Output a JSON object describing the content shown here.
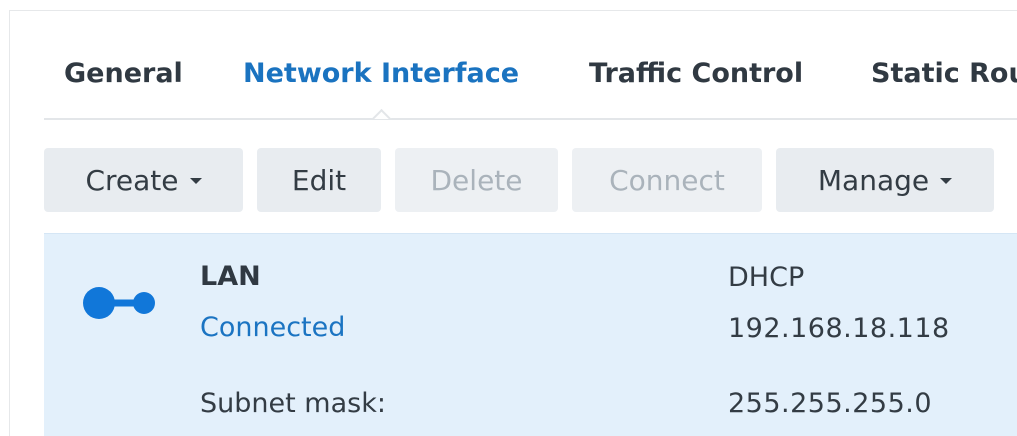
{
  "tabs": [
    {
      "label": "General",
      "active": false
    },
    {
      "label": "Network Interface",
      "active": true
    },
    {
      "label": "Traffic Control",
      "active": false
    },
    {
      "label": "Static Rou",
      "active": false
    }
  ],
  "toolbar": {
    "create_label": "Create",
    "edit_label": "Edit",
    "delete_label": "Delete",
    "connect_label": "Connect",
    "manage_label": "Manage"
  },
  "interface": {
    "icon": "connection-icon",
    "name": "LAN",
    "status": "Connected",
    "mode": "DHCP",
    "ip": "192.168.18.118",
    "subnet_label": "Subnet mask:",
    "subnet_value": "255.255.255.0"
  },
  "colors": {
    "accent": "#1a73c0",
    "icon_blue": "#1177d9",
    "selected_row": "#e3f0fb",
    "button_bg": "#e8ecf0",
    "disabled_text": "#aab3bb"
  }
}
